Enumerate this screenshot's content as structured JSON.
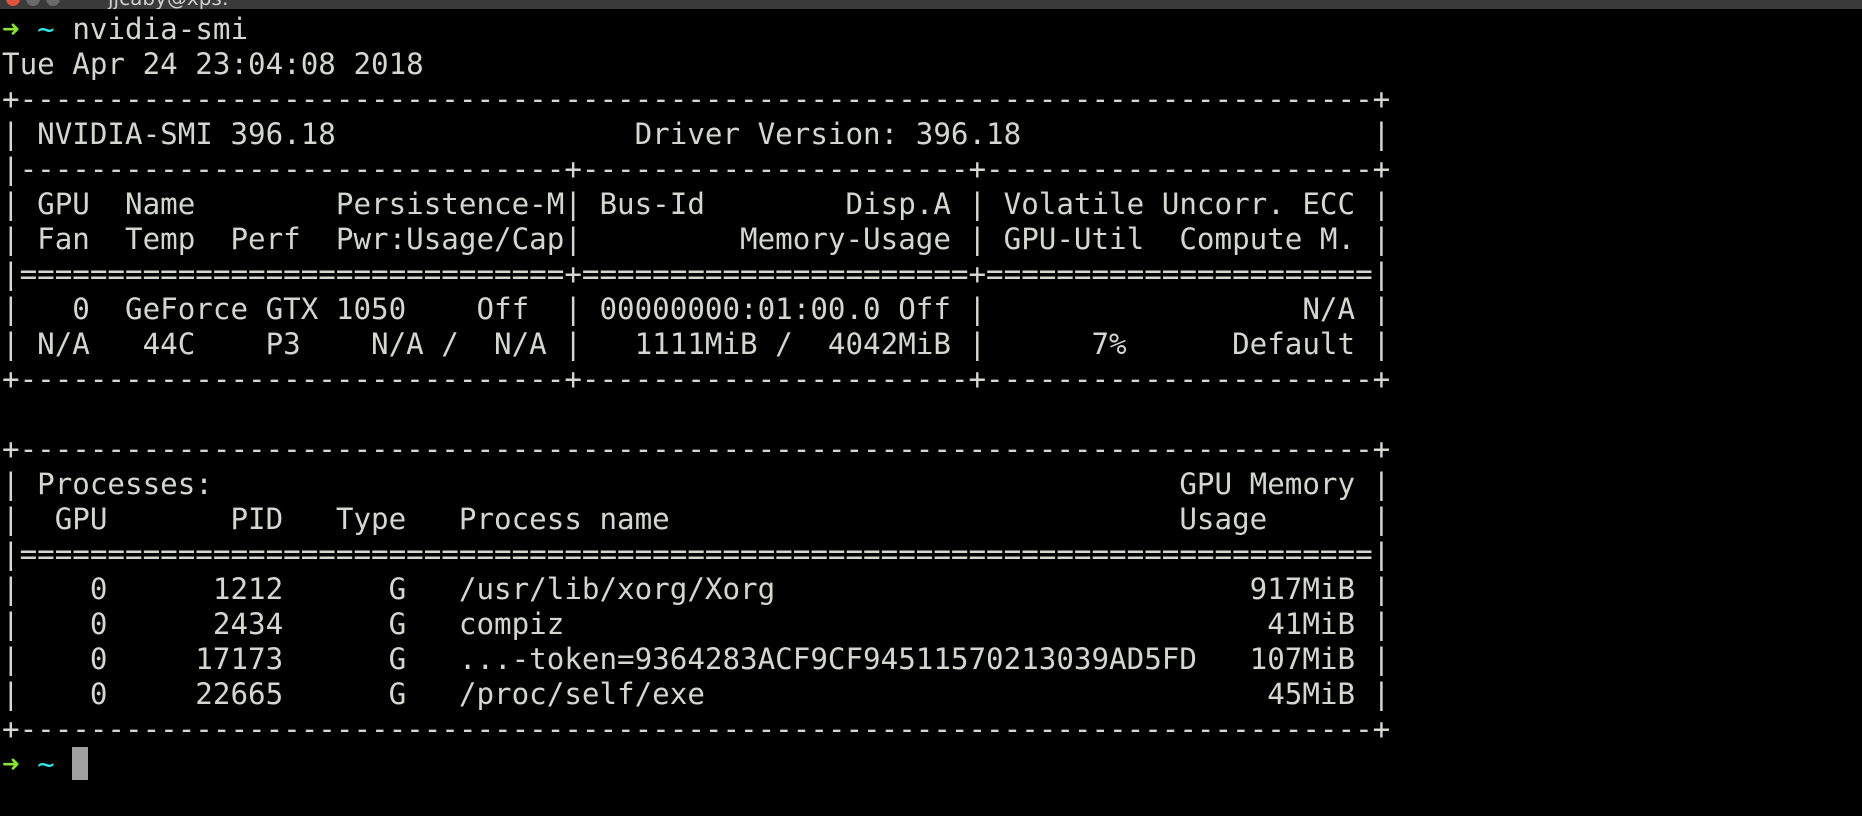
{
  "window": {
    "title": "jjcaby@xps:~"
  },
  "prompt": {
    "arrow": "➜",
    "cwd": "~",
    "command": "nvidia-smi"
  },
  "output": {
    "lines": [
      "Tue Apr 24 23:04:08 2018",
      "+-----------------------------------------------------------------------------+",
      "| NVIDIA-SMI 396.18                 Driver Version: 396.18                    |",
      "|-------------------------------+----------------------+----------------------+",
      "| GPU  Name        Persistence-M| Bus-Id        Disp.A | Volatile Uncorr. ECC |",
      "| Fan  Temp  Perf  Pwr:Usage/Cap|         Memory-Usage | GPU-Util  Compute M. |",
      "|===============================+======================+======================|",
      "|   0  GeForce GTX 1050    Off  | 00000000:01:00.0 Off |                  N/A |",
      "| N/A   44C    P3    N/A /  N/A |   1111MiB /  4042MiB |      7%      Default |",
      "+-------------------------------+----------------------+----------------------+",
      "",
      "+-----------------------------------------------------------------------------+",
      "| Processes:                                                       GPU Memory |",
      "|  GPU       PID   Type   Process name                             Usage      |",
      "|=============================================================================|",
      "|    0      1212      G   /usr/lib/xorg/Xorg                           917MiB |",
      "|    0      2434      G   compiz                                        41MiB |",
      "|    0     17173      G   ...-token=9364283ACF9CF94511570213039AD5FD   107MiB |",
      "|    0     22665      G   /proc/self/exe                                45MiB |",
      "+-----------------------------------------------------------------------------+"
    ]
  },
  "colors": {
    "background": "#000000",
    "text": "#d3d7cf",
    "prompt_arrow": "#8ae234",
    "prompt_cwd": "#34e2e2"
  }
}
